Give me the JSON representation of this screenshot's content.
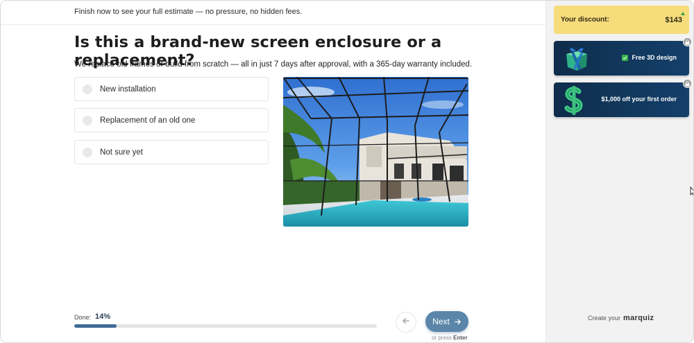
{
  "topbar": {
    "text": "Finish now to see your full estimate — no pressure, no hidden fees."
  },
  "question": {
    "title": "Is this a brand-new screen enclosure or a replacement?",
    "subtitle": "We replace old frames or build from scratch — all in just 7 days after approval, with a 365-day warranty included.",
    "options": [
      {
        "label": "New installation"
      },
      {
        "label": "Replacement of an old one"
      },
      {
        "label": "Not sure yet"
      }
    ]
  },
  "progress": {
    "label": "Done:",
    "value": "14%",
    "fraction": 0.14
  },
  "navigation": {
    "next_label": "Next",
    "hint_prefix": "or press",
    "hint_key": "Enter"
  },
  "sidebar": {
    "discount_label": "Your discount:",
    "discount_value": "$143",
    "bonuses": [
      {
        "label": "Free 3D design",
        "icon": "gift-icon",
        "checked": true,
        "locked": true
      },
      {
        "label": "$1,000 off your first order",
        "icon": "dollar-icon",
        "checked": false,
        "locked": true
      }
    ],
    "brand_prefix": "Create your",
    "brand_logo": "marquiz"
  },
  "colors": {
    "accent": "#5b86aa",
    "progress": "#3f6a96",
    "discount_bg": "#f7dc7c",
    "card_bg": "#11365a",
    "check_green": "#35b24a"
  }
}
